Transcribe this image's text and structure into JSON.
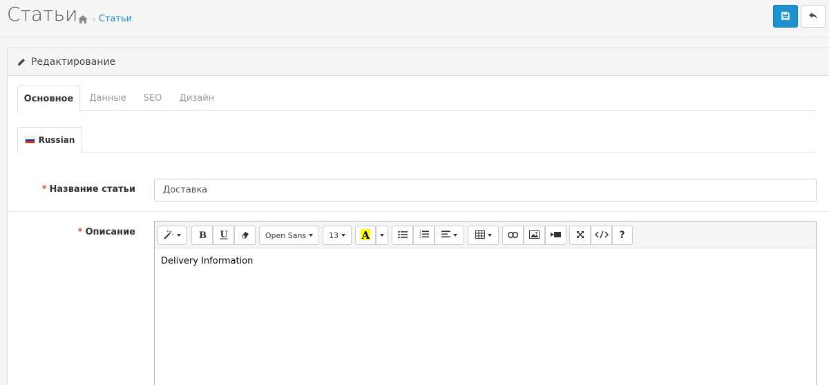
{
  "header": {
    "title": "Статьи",
    "breadcrumb_link": "Статьи",
    "save_icon": "save-icon",
    "back_icon": "reply-icon"
  },
  "panel": {
    "heading": "Редактирование"
  },
  "tabs": [
    {
      "label": "Основное",
      "active": true
    },
    {
      "label": "Данные",
      "active": false
    },
    {
      "label": "SEO",
      "active": false
    },
    {
      "label": "Дизайн",
      "active": false
    }
  ],
  "lang_tab": {
    "label": "Russian"
  },
  "form": {
    "title_label": "Название статьи",
    "title_value": "Доставка",
    "description_label": "Описание",
    "required_mark": "*"
  },
  "editor": {
    "font_name": "Open Sans",
    "font_size": "13",
    "content": "Delivery Information"
  },
  "colors": {
    "primary": "#1e91cf",
    "required": "#e3503e",
    "highlight": "#ffff00"
  }
}
